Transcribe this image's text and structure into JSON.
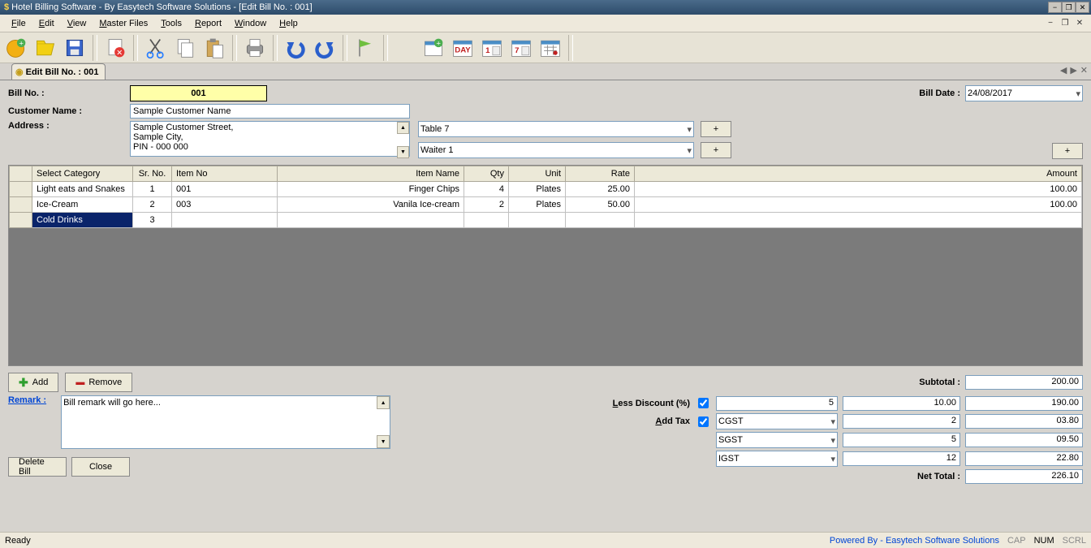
{
  "window": {
    "title": "Hotel Billing Software - By Easytech Software Solutions - [Edit Bill No. : 001]"
  },
  "menu": {
    "file": "File",
    "edit": "Edit",
    "view": "View",
    "master": "Master Files",
    "tools": "Tools",
    "report": "Report",
    "window": "Window",
    "help": "Help"
  },
  "tab": {
    "label": "Edit Bill No. : 001"
  },
  "form": {
    "billno_label": "Bill No. :",
    "billno_value": "001",
    "billdate_label": "Bill Date :",
    "billdate_value": "24/08/2017",
    "customer_label": "Customer Name :",
    "customer_value": "Sample Customer Name",
    "address_label": "Address :",
    "address_value": "Sample Customer Street,\nSample City,\nPIN - 000 000",
    "table_value": "Table 7",
    "waiter_value": "Waiter 1",
    "plus": "+"
  },
  "grid": {
    "headers": {
      "category": "Select Category",
      "srno": "Sr. No.",
      "itemno": "Item No",
      "itemname": "Item Name",
      "qty": "Qty",
      "unit": "Unit",
      "rate": "Rate",
      "amount": "Amount"
    },
    "rows": [
      {
        "category": "Light eats and Snakes",
        "srno": "1",
        "itemno": "001",
        "itemname": "Finger Chips",
        "qty": "4",
        "unit": "Plates",
        "rate": "25.00",
        "amount": "100.00"
      },
      {
        "category": "Ice-Cream",
        "srno": "2",
        "itemno": "003",
        "itemname": "Vanila Ice-cream",
        "qty": "2",
        "unit": "Plates",
        "rate": "50.00",
        "amount": "100.00"
      },
      {
        "category": "Cold Drinks",
        "srno": "3",
        "itemno": "",
        "itemname": "",
        "qty": "",
        "unit": "",
        "rate": "",
        "amount": ""
      }
    ]
  },
  "buttons": {
    "add": "Add",
    "remove": "Remove",
    "delete": "Delete Bill",
    "close": "Close"
  },
  "remark": {
    "label": "Remark :",
    "value": "Bill remark will go here..."
  },
  "totals": {
    "subtotal_label": "Subtotal :",
    "subtotal": "200.00",
    "discount_label": "Less Discount (%)",
    "discount_pct": "5",
    "discount_amt": "10.00",
    "after_discount": "190.00",
    "tax_label": "Add Tax",
    "taxes": [
      {
        "name": "CGST",
        "pct": "2",
        "amt": "03.80"
      },
      {
        "name": "SGST",
        "pct": "5",
        "amt": "09.50"
      },
      {
        "name": "IGST",
        "pct": "12",
        "amt": "22.80"
      }
    ],
    "nettotal_label": "Net Total :",
    "nettotal": "226.10"
  },
  "status": {
    "ready": "Ready",
    "powered": "Powered By - Easytech Software Solutions",
    "cap": "CAP",
    "num": "NUM",
    "scrl": "SCRL"
  }
}
